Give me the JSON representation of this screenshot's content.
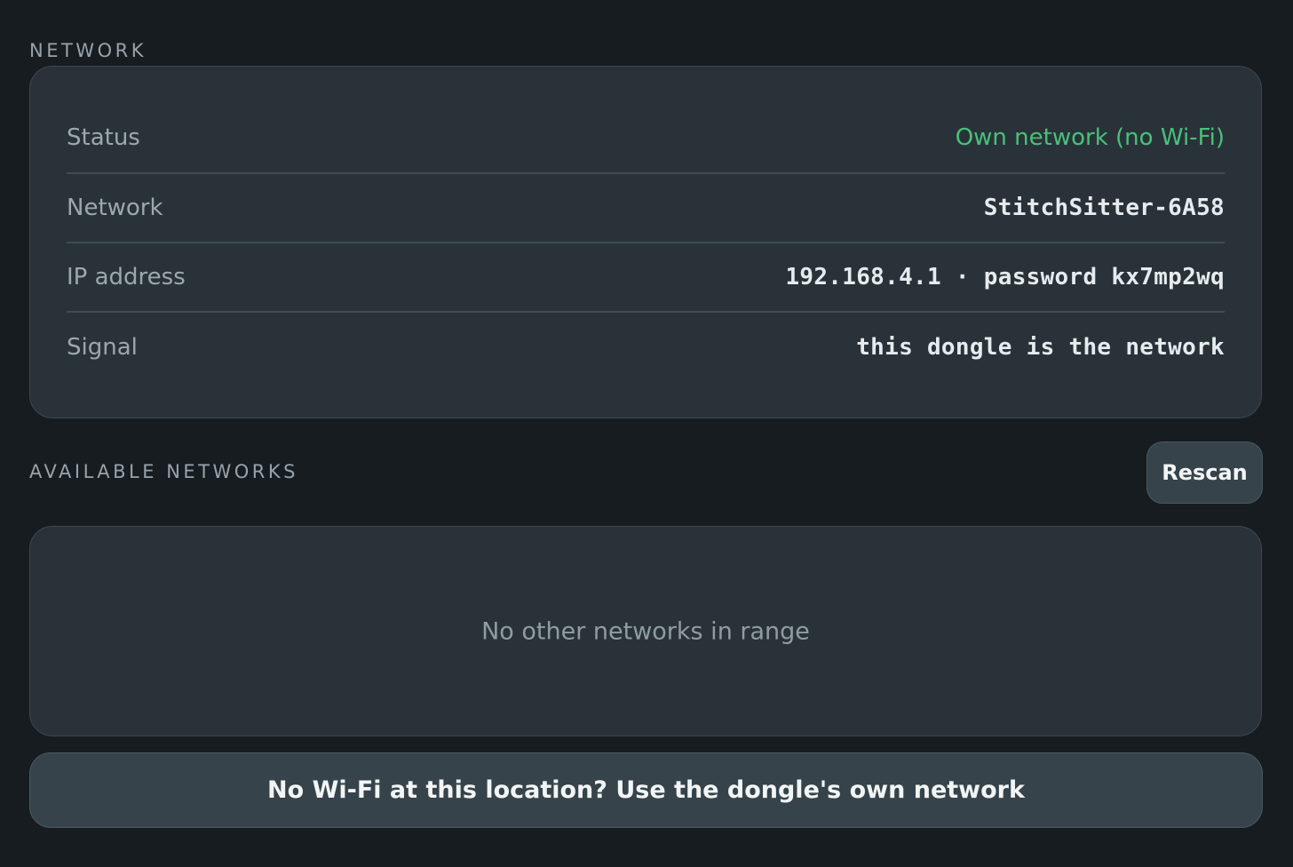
{
  "network": {
    "heading": "NETWORK",
    "rows": [
      {
        "label": "Status",
        "value": "Own network (no Wi-Fi)",
        "value_color": "#49c17a"
      },
      {
        "label": "Network",
        "value": "StitchSitter-6A58"
      },
      {
        "label": "IP address",
        "value": "192.168.4.1 · password kx7mp2wq"
      },
      {
        "label": "Signal",
        "value": "this dongle is the network"
      }
    ]
  },
  "available_networks": {
    "heading": "AVAILABLE NETWORKS",
    "rescan_label": "Rescan",
    "empty_message": "No other networks in range"
  },
  "own_network_button_label": "No Wi-Fi at this location? Use the dongle's own network",
  "colors": {
    "background": "#171c20",
    "card": "#2a3239",
    "status_ok": "#49c17a",
    "button": "#36434a"
  }
}
